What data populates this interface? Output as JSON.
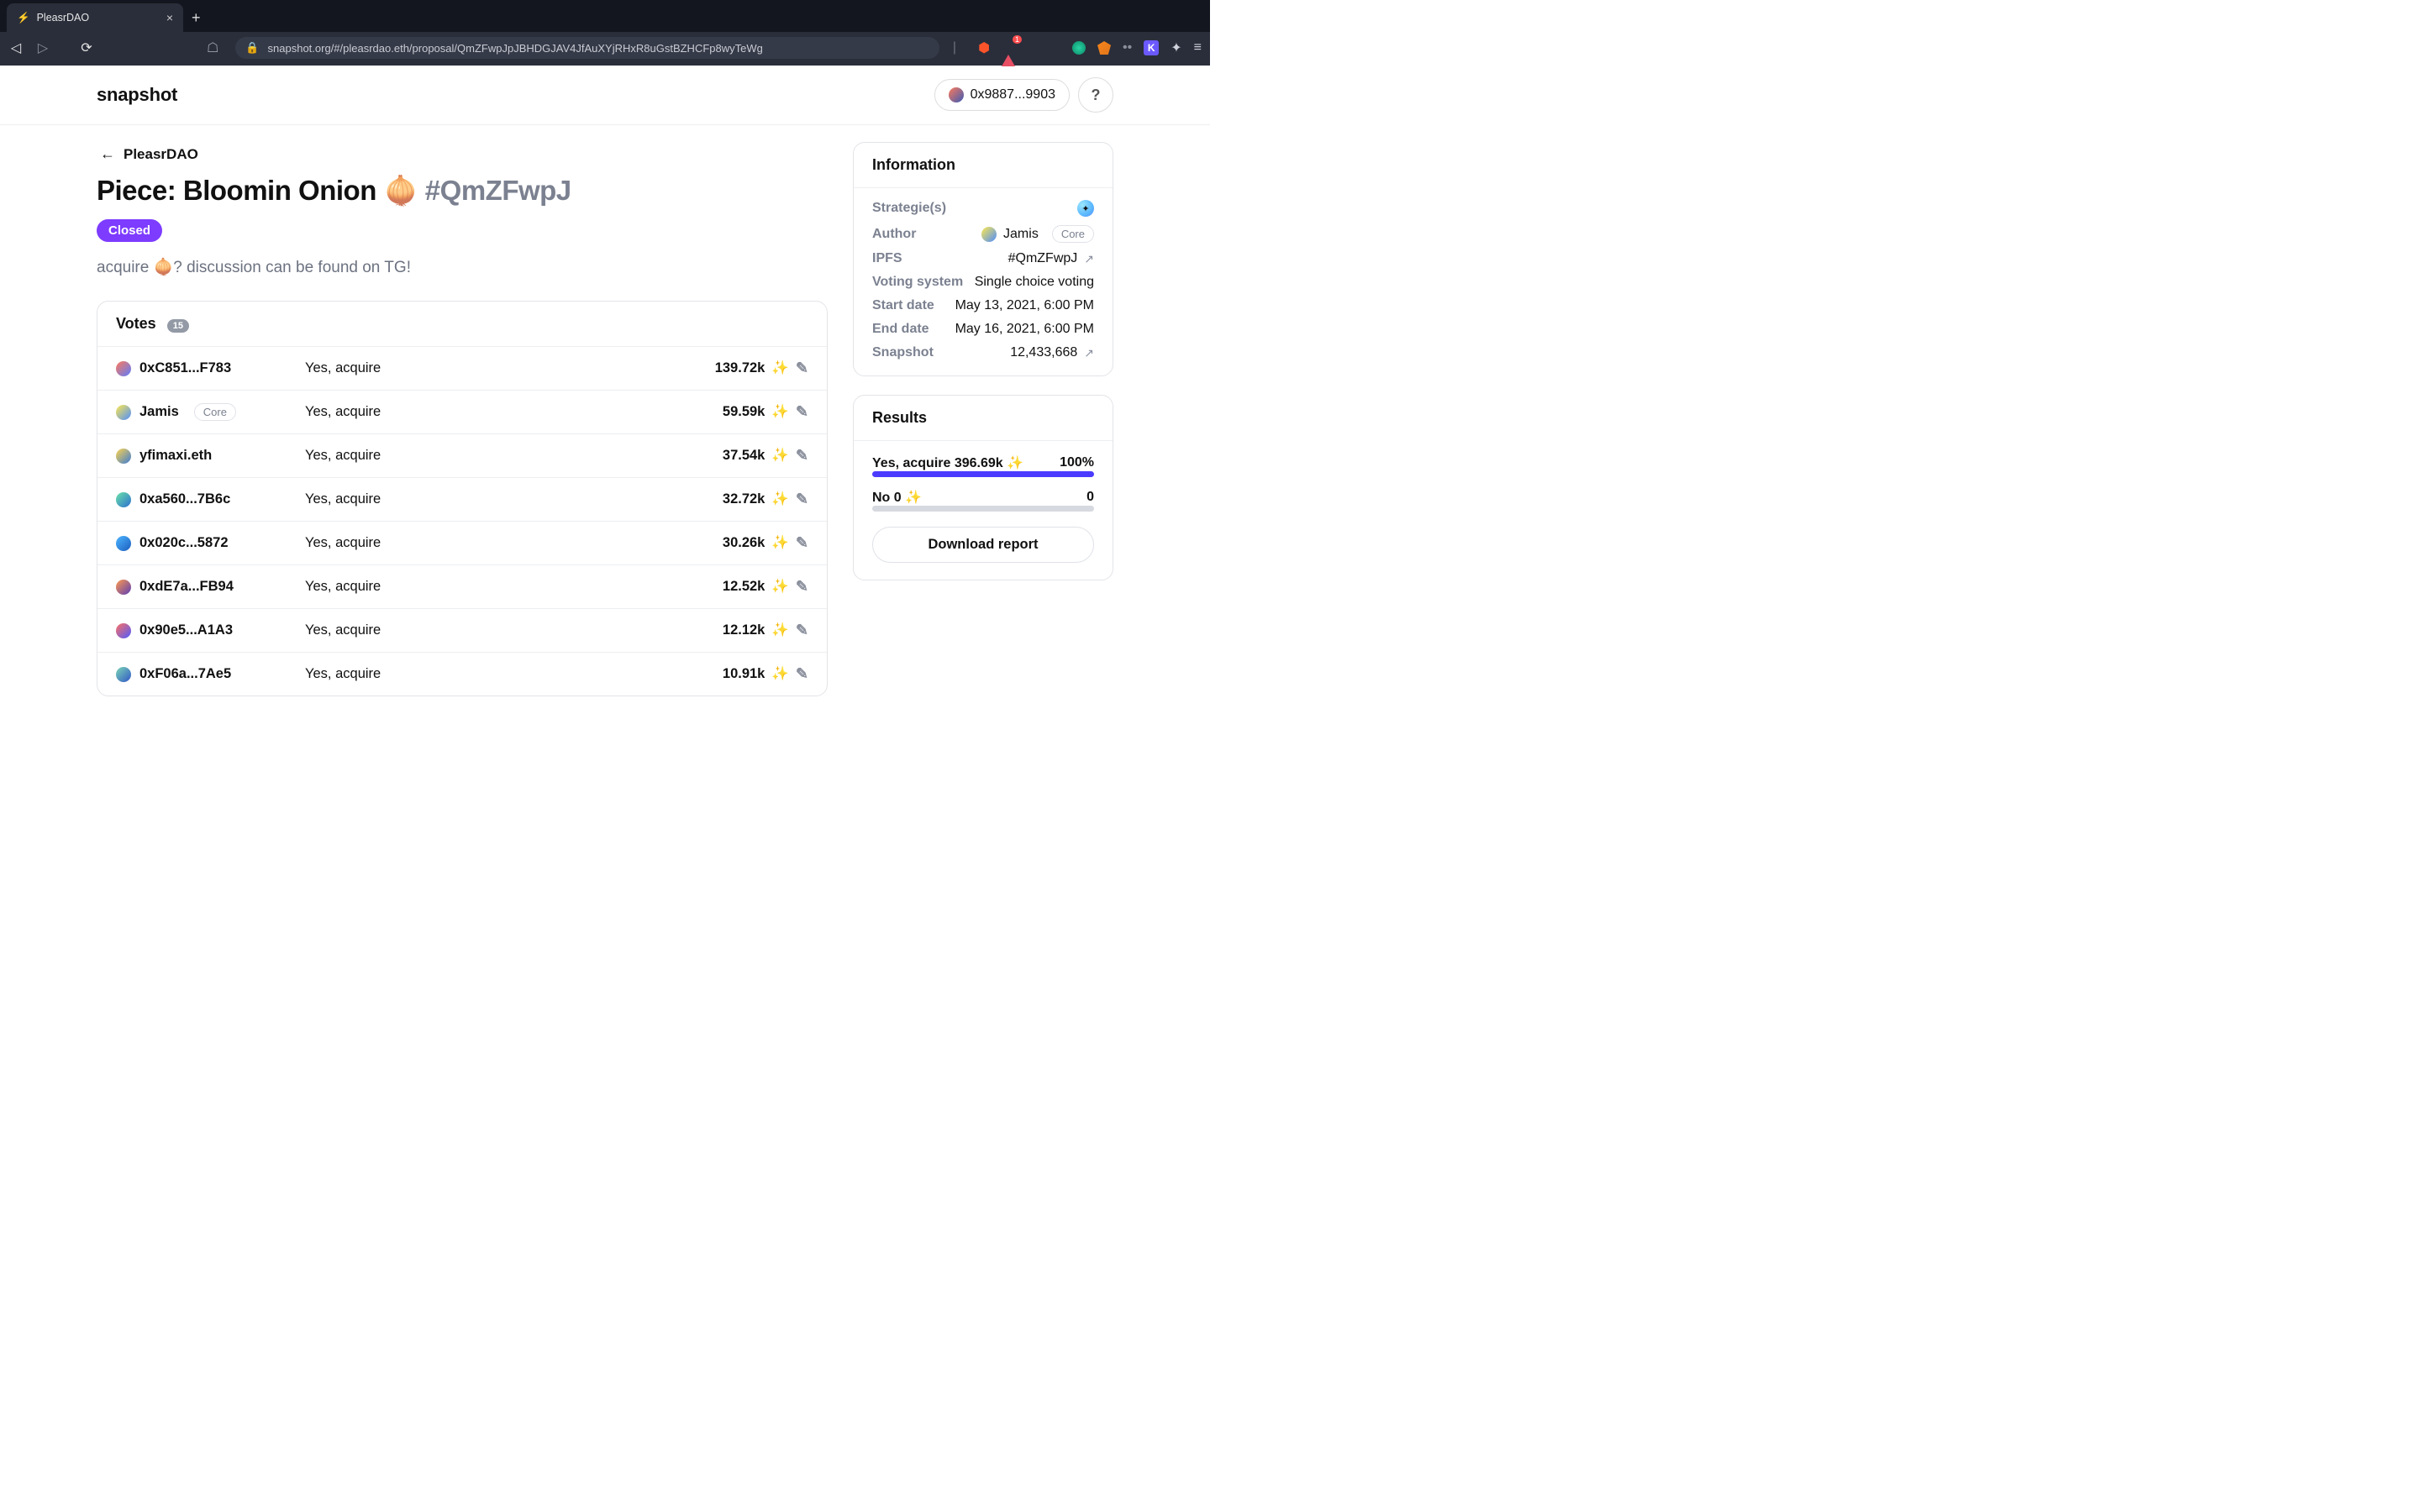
{
  "browser": {
    "tab_title": "PleasrDAO",
    "url": "snapshot.org/#/pleasrdao.eth/proposal/QmZFwpJpJBHDGJAV4JfAuXYjRHxR8uGstBZHCFp8wyTeWg"
  },
  "header": {
    "logo": "snapshot",
    "wallet": "0x9887...9903",
    "help": "?"
  },
  "back": {
    "label": "PleasrDAO"
  },
  "proposal": {
    "title_prefix": "Piece: Bloomin Onion 🧅 ",
    "title_hash": "#QmZFwpJ",
    "status": "Closed",
    "description": "acquire 🧅? discussion can be found on TG!"
  },
  "votes": {
    "heading": "Votes",
    "count": "15",
    "rows": [
      {
        "voter": "0xC851...F783",
        "core": false,
        "choice": "Yes, acquire",
        "amount": "139.72k",
        "avatar": "g1"
      },
      {
        "voter": "Jamis",
        "core": true,
        "choice": "Yes, acquire",
        "amount": "59.59k",
        "avatar": "g2"
      },
      {
        "voter": "yfimaxi.eth",
        "core": false,
        "choice": "Yes, acquire",
        "amount": "37.54k",
        "avatar": "g3"
      },
      {
        "voter": "0xa560...7B6c",
        "core": false,
        "choice": "Yes, acquire",
        "amount": "32.72k",
        "avatar": "g4"
      },
      {
        "voter": "0x020c...5872",
        "core": false,
        "choice": "Yes, acquire",
        "amount": "30.26k",
        "avatar": "g5"
      },
      {
        "voter": "0xdE7a...FB94",
        "core": false,
        "choice": "Yes, acquire",
        "amount": "12.52k",
        "avatar": "g6"
      },
      {
        "voter": "0x90e5...A1A3",
        "core": false,
        "choice": "Yes, acquire",
        "amount": "12.12k",
        "avatar": "g7"
      },
      {
        "voter": "0xF06a...7Ae5",
        "core": false,
        "choice": "Yes, acquire",
        "amount": "10.91k",
        "avatar": "g8"
      }
    ]
  },
  "info": {
    "heading": "Information",
    "strategies_label": "Strategie(s)",
    "author_label": "Author",
    "author_name": "Jamis",
    "author_core": "Core",
    "ipfs_label": "IPFS",
    "ipfs_value": "#QmZFwpJ",
    "voting_label": "Voting system",
    "voting_value": "Single choice voting",
    "start_label": "Start date",
    "start_value": "May 13, 2021, 6:00 PM",
    "end_label": "End date",
    "end_value": "May 16, 2021, 6:00 PM",
    "snapshot_label": "Snapshot",
    "snapshot_value": "12,433,668"
  },
  "results": {
    "heading": "Results",
    "opt1_label": "Yes, acquire 396.69k",
    "opt1_pct": "100%",
    "opt1_fill": 100,
    "opt2_label": "No 0",
    "opt2_pct": "0",
    "opt2_fill": 0,
    "download": "Download report"
  }
}
